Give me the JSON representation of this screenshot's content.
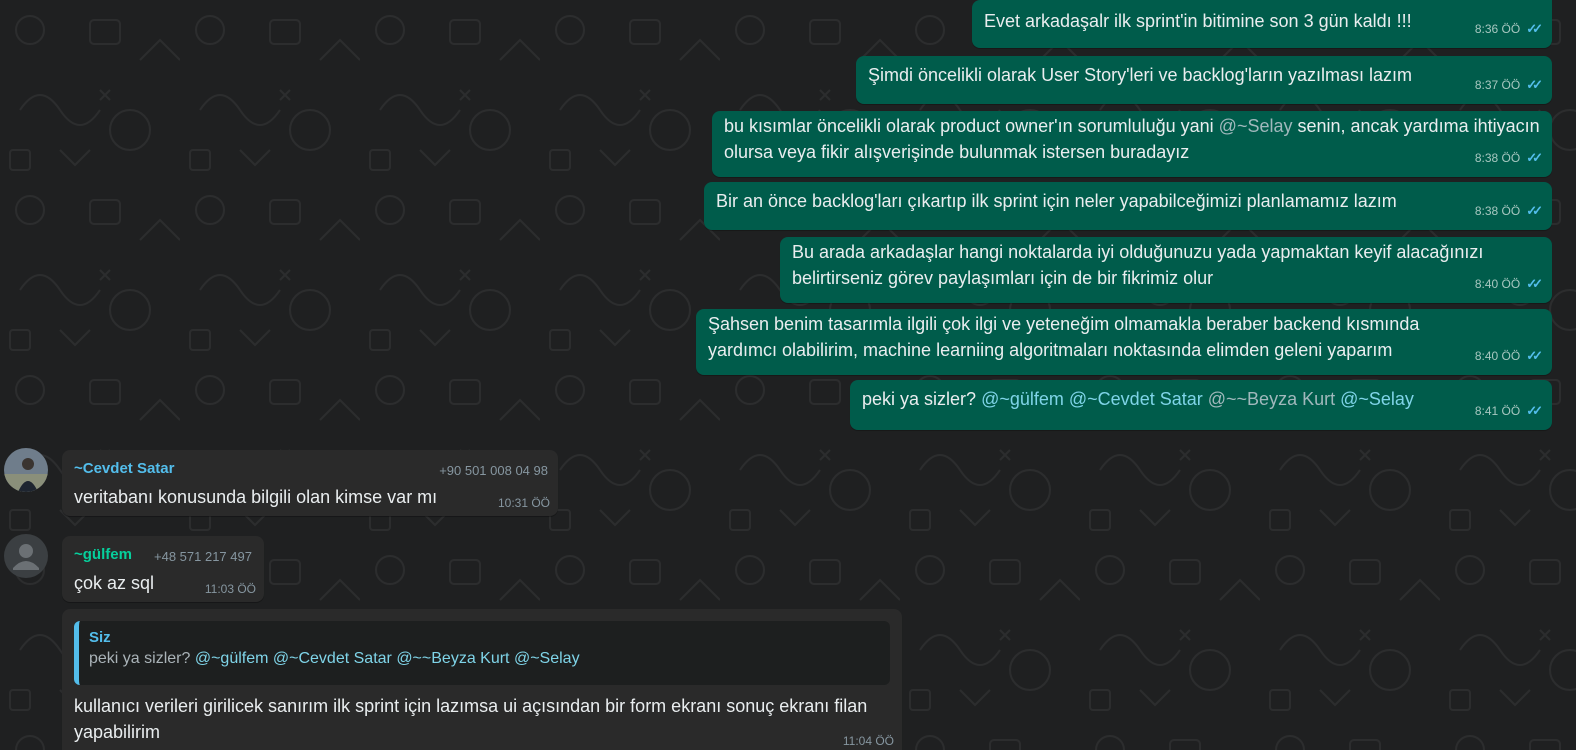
{
  "outgoing": [
    {
      "text": "Evet arkadaşalr ilk sprint'in bitimine son 3 gün kaldı !!!",
      "time": "8:36 ÖÖ"
    },
    {
      "text": "Şimdi öncelikli olarak User Story'leri ve backlog'ların yazılması lazım",
      "time": "8:37 ÖÖ"
    },
    {
      "text_before": "bu kısımlar öncelikli olarak product owner'ın sorumluluğu yani ",
      "mention": "@~Selay",
      "text_after": "  senin, ancak yardıma ihtiyacın olursa veya fikir alışverişinde bulunmak istersen buradayız",
      "time": "8:38 ÖÖ"
    },
    {
      "text": "Bir an önce backlog'ları çıkartıp ilk sprint için neler yapabilceğimizi planlamamız lazım",
      "time": "8:38 ÖÖ"
    },
    {
      "text": "Bu arada arkadaşlar hangi noktalarda iyi olduğunuzu yada yapmaktan keyif alacağınızı belirtirseniz görev paylaşımları için de bir fikrimiz olur",
      "time": "8:40 ÖÖ"
    },
    {
      "text": "Şahsen benim tasarımla ilgili çok ilgi ve yeteneğim olmamakla beraber backend kısmında yardımcı olabilirim, machine learniing algoritmaları noktasında elimden geleni yaparım",
      "time": "8:40 ÖÖ"
    },
    {
      "text": "peki ya sizler? ",
      "mentions": [
        "@~gülfem",
        "@~Cevdet Satar",
        "@~~Beyza Kurt",
        "@~Selay"
      ],
      "time": "8:41 ÖÖ"
    }
  ],
  "incoming": [
    {
      "sender": "~Cevdet Satar",
      "sender_color": "#53bdeb",
      "phone": "+90 501 008 04 98",
      "text": "veritabanı konusunda bilgili olan kimse var mı",
      "time": "10:31 ÖÖ"
    },
    {
      "sender": "~gülfem",
      "sender_color": "#06cf9c",
      "phone": "+48 571 217 497",
      "text": "çok az sql",
      "time": "11:03 ÖÖ"
    },
    {
      "quote_sender": "Siz",
      "quote_text": "peki ya sizler? ",
      "quote_mentions": [
        "@~gülfem",
        "@~Cevdet Satar",
        "@~~Beyza Kurt",
        "@~Selay"
      ],
      "text": "kullanıcı verileri girilicek sanırım ilk sprint için lazımsa ui açısından bir form ekranı sonuç ekranı filan yapabilirim",
      "time": "11:04 ÖÖ"
    }
  ],
  "icons": {
    "read_receipt": "double-check-icon",
    "default_avatar": "user-silhouette-icon"
  }
}
